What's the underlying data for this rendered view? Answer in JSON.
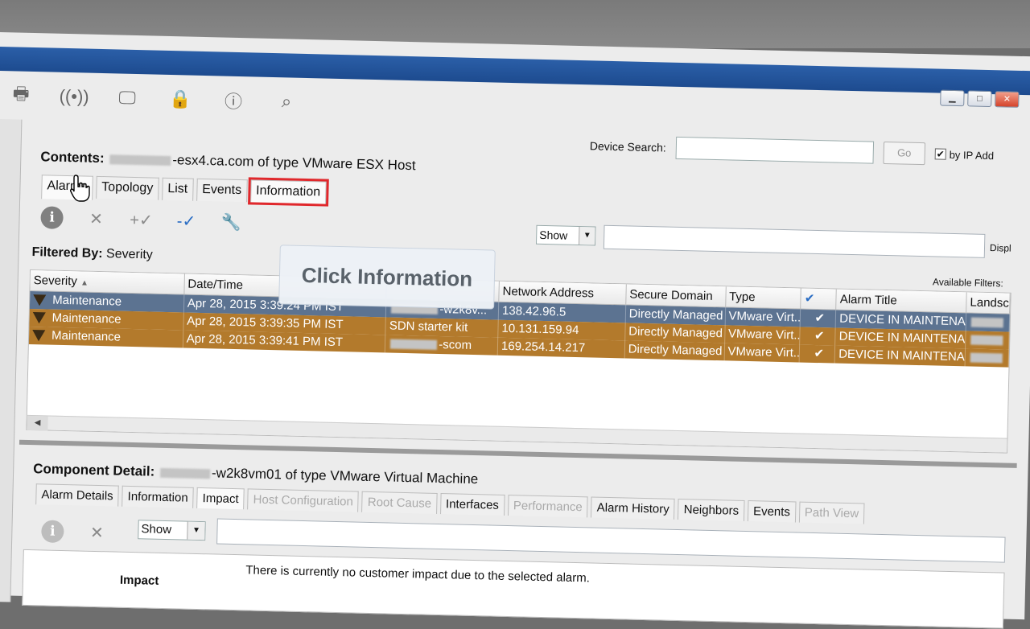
{
  "window": {
    "buttons": [
      "minimize",
      "maximize",
      "close"
    ]
  },
  "toolbar": {
    "icons": [
      "printer-icon",
      "signal-icon",
      "monitor-icon",
      "lock-network-icon",
      "info-icon",
      "find-icon"
    ]
  },
  "search": {
    "label": "Device Search:",
    "value": "",
    "go_label": "Go",
    "by_ip_label": "by IP Add",
    "by_ip_checked": true
  },
  "contents": {
    "label": "Contents:",
    "text": "-esx4.ca.com of type VMware ESX Host"
  },
  "tabs": [
    "Alarms",
    "Topology",
    "List",
    "Events",
    "Information"
  ],
  "active_tab": "Alarms",
  "highlighted_tab": "Information",
  "actions": {
    "show_label": "Show",
    "filter_value": "",
    "display_label": "Displ",
    "filtered_by_label": "Filtered By:",
    "filtered_by_value": "Severity",
    "available_filters": "Available Filters:"
  },
  "callout": {
    "text": "Click Information"
  },
  "grid": {
    "columns": [
      "Severity",
      "Date/Time",
      "",
      "Network Address",
      "Secure Domain",
      "Type",
      "",
      "Alarm Title",
      "Landscap"
    ],
    "rows": [
      {
        "severity": "Maintenance",
        "datetime": "Apr 28, 2015 3:39:24 PM IST",
        "name": "-w2k8v...",
        "address": "138.42.96.5",
        "domain": "Directly Managed",
        "type": "VMware Virt...",
        "ack": "✔",
        "title": "DEVICE IN MAINTENANCE...",
        "style": "sel"
      },
      {
        "severity": "Maintenance",
        "datetime": "Apr 28, 2015 3:39:35 PM IST",
        "name": "SDN starter kit",
        "address": "10.131.159.94",
        "domain": "Directly Managed",
        "type": "VMware Virt...",
        "ack": "✔",
        "title": "DEVICE IN MAINTENANCE...",
        "style": "orange"
      },
      {
        "severity": "Maintenance",
        "datetime": "Apr 28, 2015 3:39:41 PM IST",
        "name": "-scom",
        "address": "169.254.14.217",
        "domain": "Directly Managed",
        "type": "VMware Virt...",
        "ack": "✔",
        "title": "DEVICE IN MAINTENANCE...",
        "style": "orange"
      }
    ]
  },
  "component_detail": {
    "label": "Component Detail:",
    "text": "-w2k8vm01 of type VMware Virtual Machine",
    "tabs": [
      {
        "label": "Alarm Details",
        "state": "normal"
      },
      {
        "label": "Information",
        "state": "normal"
      },
      {
        "label": "Impact",
        "state": "active"
      },
      {
        "label": "Host Configuration",
        "state": "disabled"
      },
      {
        "label": "Root Cause",
        "state": "disabled"
      },
      {
        "label": "Interfaces",
        "state": "normal"
      },
      {
        "label": "Performance",
        "state": "disabled"
      },
      {
        "label": "Alarm History",
        "state": "normal"
      },
      {
        "label": "Neighbors",
        "state": "normal"
      },
      {
        "label": "Events",
        "state": "normal"
      },
      {
        "label": "Path View",
        "state": "disabled"
      }
    ],
    "show_label": "Show",
    "filter_value": "",
    "impact_label": "Impact",
    "impact_message": "There is currently no customer impact due to the selected alarm."
  },
  "colors": {
    "title_bar": "#1d4b8f",
    "selected_row": "#5c7391",
    "maintenance_row": "#b37a2c",
    "highlight_outline": "#e0282c"
  }
}
